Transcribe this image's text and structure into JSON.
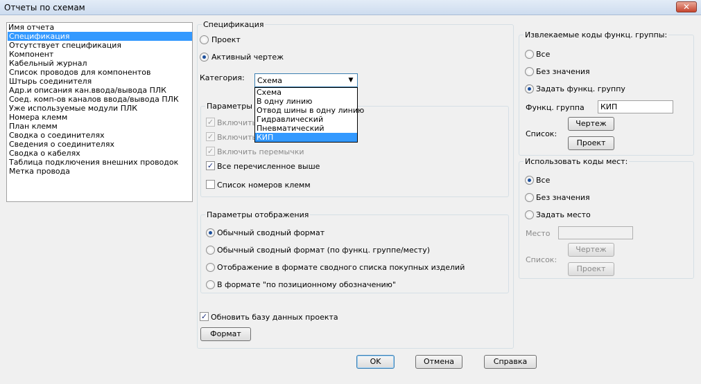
{
  "window": {
    "title": "Отчеты по схемам",
    "close": "✕"
  },
  "report_list": {
    "header": "Имя отчета",
    "items": [
      "Спецификация",
      "Отсутствует спецификация",
      "Компонент",
      "Кабельный журнал",
      "Список проводов для компонентов",
      "Штырь соединителя",
      "Адр.и описания кан.ввода/вывода ПЛК",
      "Соед. комп-ов каналов ввода/вывода ПЛК",
      "Уже используемые модули ПЛК",
      "Номера клемм",
      "План клемм",
      "Сводка о соединителях",
      "Сведения о соединителях",
      "Сводка о кабелях",
      "Таблица подключения внешних проводок",
      "Метка провода"
    ],
    "selected": "Спецификация"
  },
  "spec": {
    "legend": "Спецификация",
    "project": "Проект",
    "active_drawing": "Активный чертеж",
    "category_label": "Категория:",
    "category_value": "Схема",
    "dropdown_options": [
      "Схема",
      "В одну линию",
      "Отвод шины в одну линию",
      "Гидравлический",
      "Пневматический",
      "КИП"
    ],
    "dropdown_selected": "КИП"
  },
  "output_params": {
    "legend": "Параметры вы",
    "inc1": "Включить к",
    "inc2": "Включить с",
    "inc_jumpers": "Включить перемычки",
    "all_above": "Все перечисленное выше",
    "terminal_list": "Список номеров клемм"
  },
  "display_params": {
    "legend": "Параметры отображения",
    "opt1": "Обычный сводный формат",
    "opt2": "Обычный сводный формат (по функц. группе/месту)",
    "opt3": "Отображение в формате сводного списка покупных изделий",
    "opt4": "В формате \"по позиционному обозначению\""
  },
  "update_db": "Обновить базу данных проекта",
  "format_button": "Формат",
  "func_group": {
    "legend": "Извлекаемые коды функц. группы:",
    "all": "Все",
    "no_value": "Без значения",
    "set": "Задать функц. группу",
    "field_label": "Функц. группа",
    "field_value": "КИП",
    "list_label": "Список:",
    "drawing_btn": "Чертеж",
    "project_btn": "Проект"
  },
  "location": {
    "legend": "Использовать коды мест:",
    "all": "Все",
    "no_value": "Без значения",
    "set": "Задать место",
    "field_label": "Место",
    "field_value": "",
    "list_label": "Список:",
    "drawing_btn": "Чертеж",
    "project_btn": "Проект"
  },
  "footer": {
    "ok": "OK",
    "cancel": "Отмена",
    "help": "Справка"
  }
}
